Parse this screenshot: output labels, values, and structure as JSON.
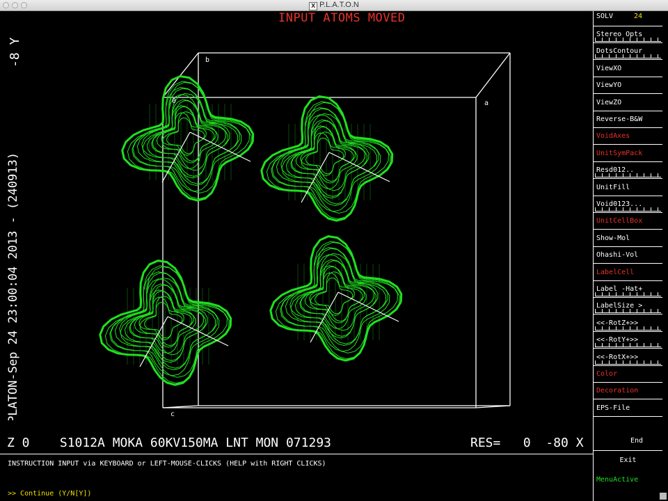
{
  "window": {
    "title": "P.L.A.T.O.N"
  },
  "viewer": {
    "overlay_title": "INPUT ATOMS MOVED",
    "vertical_caption": "PLATON-Sep 24 23:00:04 2013 - (240913)",
    "vertical_axis": "-8 Y",
    "status_left": "Z 0    S1012A MOKA 60KV150MA LNT MON 071293",
    "status_right": "RES=   0  -80 X",
    "axis_labels": {
      "b": "b",
      "o": "0",
      "a": "a",
      "c": "c"
    },
    "colors": {
      "void_surface": "#20e020",
      "overlay_title": "#e8332a",
      "cell_box": "#ffffff"
    }
  },
  "menu": {
    "solv_label": "SOLV",
    "solv_value": "24",
    "items": [
      {
        "label": "Stereo Opts",
        "color": "white",
        "slider": true
      },
      {
        "label": "DotsContour",
        "color": "white",
        "slider": true
      },
      {
        "label": "ViewXO",
        "color": "white",
        "slider": false
      },
      {
        "label": "ViewYO",
        "color": "white",
        "slider": false
      },
      {
        "label": "ViewZO",
        "color": "white",
        "slider": false
      },
      {
        "label": "Reverse-B&W",
        "color": "white",
        "slider": false
      },
      {
        "label": "VoidAxes",
        "color": "red",
        "slider": false
      },
      {
        "label": "UnitSymPack",
        "color": "red",
        "slider": false
      },
      {
        "label": "Resd012..",
        "color": "white",
        "slider": true
      },
      {
        "label": "UnitFill",
        "color": "white",
        "slider": false
      },
      {
        "label": "Void0123...",
        "color": "white",
        "slider": true
      },
      {
        "label": "UnitCellBox",
        "color": "red",
        "slider": false
      },
      {
        "label": "Show-Mol",
        "color": "white",
        "slider": false
      },
      {
        "label": "Ohashi-Vol",
        "color": "white",
        "slider": false
      },
      {
        "label": "LabelCell",
        "color": "red",
        "slider": false
      },
      {
        "label": "Label -Hat+",
        "color": "white",
        "slider": true
      },
      {
        "label": "LabelSize >",
        "color": "white",
        "slider": true
      },
      {
        "label": "<<-RotZ+>>",
        "color": "white",
        "slider": true
      },
      {
        "label": "<<-RotY+>>",
        "color": "white",
        "slider": true
      },
      {
        "label": "<<-RotX+>>",
        "color": "white",
        "slider": true
      },
      {
        "label": "Color",
        "color": "red",
        "slider": false
      },
      {
        "label": "Decoration",
        "color": "red",
        "slider": false
      },
      {
        "label": "EPS-File",
        "color": "white",
        "slider": false
      }
    ],
    "end_label": "End",
    "exit_label": "Exit",
    "menu_active_label": "MenuActive"
  },
  "console": {
    "instruction": "INSTRUCTION INPUT via KEYBOARD or LEFT-MOUSE-CLICKS (HELP with RIGHT CLICKS)",
    "prompt": ">> Continue (Y/N[Y])"
  }
}
